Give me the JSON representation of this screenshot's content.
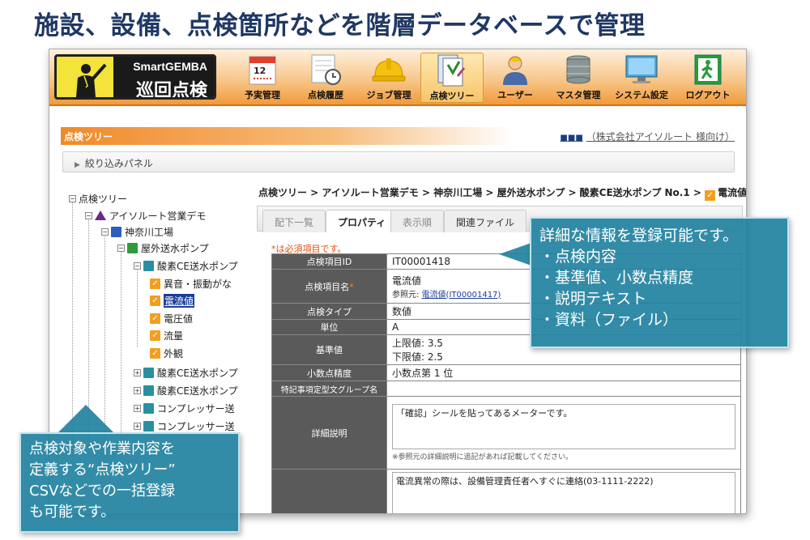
{
  "headline": "施設、設備、点検箇所などを階層データベースで管理",
  "app": {
    "logo_line1": "SmartGEMBA",
    "logo_line2": "巡回点検",
    "nav": [
      {
        "label": "予実管理",
        "icon": "calendar-icon"
      },
      {
        "label": "点検履歴",
        "icon": "history-clock-icon"
      },
      {
        "label": "ジョブ管理",
        "icon": "hardhat-icon"
      },
      {
        "label": "点検ツリー",
        "icon": "tree-document-icon"
      },
      {
        "label": "ユーザー",
        "icon": "user-icon"
      },
      {
        "label": "マスタ管理",
        "icon": "database-icon"
      },
      {
        "label": "システム設定",
        "icon": "monitor-icon"
      },
      {
        "label": "ログアウト",
        "icon": "exit-icon"
      }
    ],
    "section_title": "点検ツリー",
    "company": "（株式会社アイソルート 様向け）",
    "filter_label": "絞り込みパネル",
    "tree": {
      "root": "点検ツリー",
      "org": "アイソルート営業デモ",
      "site": "神奈川工場",
      "area": "屋外送水ポンプ",
      "equipment": "酸素CE送水ポンプ",
      "items": [
        "異音・振動がな",
        "電流値",
        "電圧値",
        "流量",
        "外観"
      ],
      "siblings": [
        "酸素CE送水ポンプ",
        "酸素CE送水ポンプ",
        "コンプレッサー送",
        "コンプレッサー送"
      ]
    },
    "breadcrumb": "点検ツリー > アイソルート営業デモ > 神奈川工場 > 屋外送水ポンプ > 酸素CE送水ポンプ No.1 >",
    "breadcrumb_last": "電流値",
    "tabs": [
      "配下一覧",
      "プロパティ",
      "表示順",
      "関連ファイル"
    ],
    "required_note": "*は必須項目です。",
    "properties": {
      "id_label": "点検項目ID",
      "id_value": "IT00001418",
      "name_label": "点検項目名",
      "name_value": "電流値",
      "ref_prefix": "参照元:",
      "ref_link": "電流値(IT00001417)",
      "type_label": "点検タイプ",
      "type_value": "数値",
      "unit_label": "単位",
      "unit_value": "A",
      "std_label": "基準値",
      "std_upper": "上限値: 3.5",
      "std_lower": "下限値: 2.5",
      "precision_label": "小数点精度",
      "precision_value": "小数点第 1 位",
      "group_label": "特記事項定型文グループ名",
      "group_value": "",
      "desc_label": "詳細説明",
      "desc_value": "「確認」シールを貼ってあるメーターです。",
      "desc_note": "※参照元の詳細説明に追記があれば記載してください。",
      "desc2_value": "電流異常の際は、設備管理責任者へすぐに連絡(03-1111-2222)"
    }
  },
  "callout_right": {
    "title": "詳細な情報を登録可能です。",
    "bullets": [
      "・点検内容",
      "・基準値、小数点精度",
      "・説明テキスト",
      "・資料（ファイル）"
    ]
  },
  "callout_left": {
    "lines": [
      "点検対象や作業内容を",
      "定義する“点検ツリー”",
      "CSVなどでの一括登録",
      "も可能です。"
    ]
  },
  "colors": {
    "headline": "#1f3864",
    "accent_orange": "#f08a2a",
    "callout": "#2282a0",
    "required": "#e05010"
  }
}
